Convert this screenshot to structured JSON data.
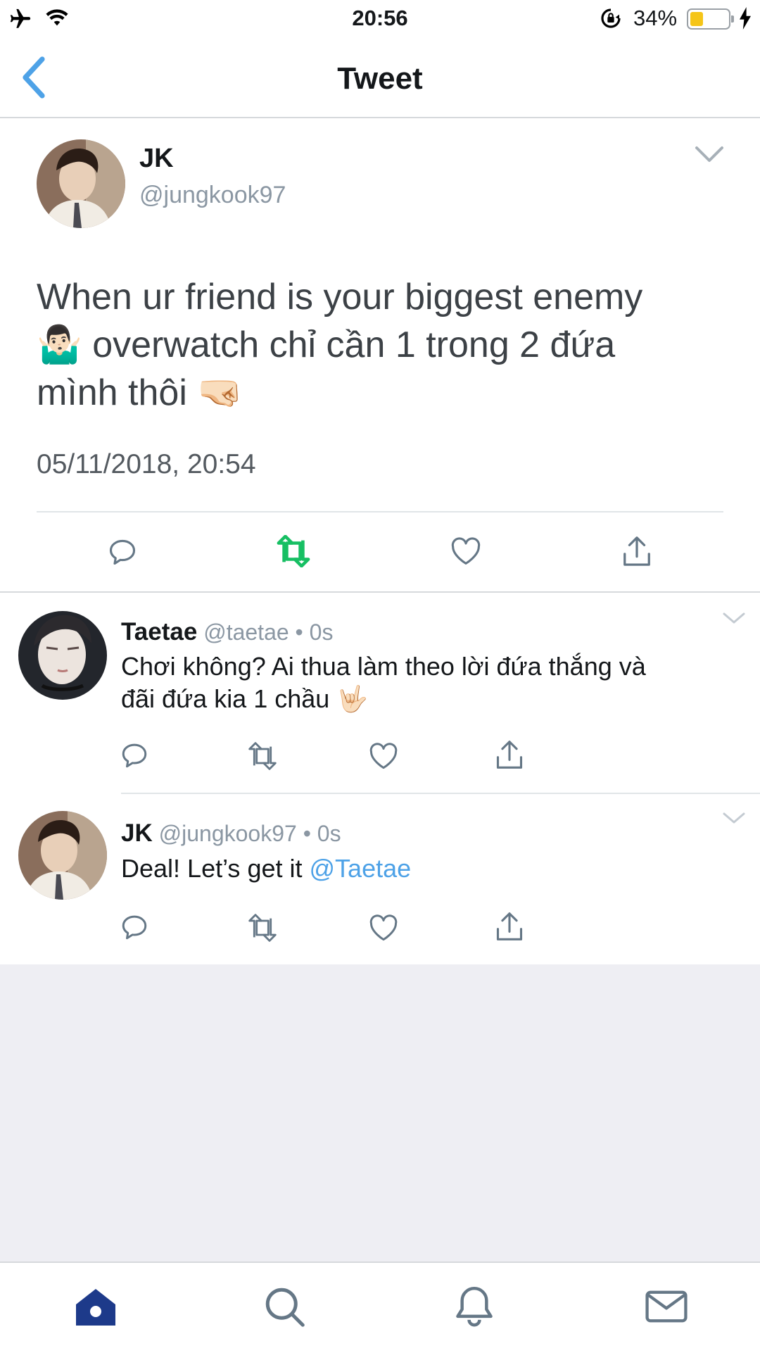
{
  "status_bar": {
    "time": "20:56",
    "battery": "34%",
    "icons": [
      "airplane-icon",
      "wifi-icon",
      "orientation-lock-icon",
      "battery-icon",
      "charging-bolt-icon"
    ]
  },
  "nav": {
    "title": "Tweet",
    "back_icon": "chevron-left-icon"
  },
  "main_tweet": {
    "name": "JK",
    "handle": "@jungkook97",
    "text_line1": "When ur friend is your biggest enemy",
    "text_line2": " overwatch chỉ cần 1 trong 2 đứa",
    "text_line3": "mình thôi ",
    "emoji_1": "🤷🏻‍♂️",
    "emoji_2": "🤜🏻",
    "timestamp": "05/11/2018, 20:54",
    "retweet_active_color": "#17bf63"
  },
  "replies": [
    {
      "name": "Taetae",
      "handle": "@taetae",
      "meta": " • 0s",
      "text_line1": "Chơi không? Ai thua làm theo lời đứa thắng và",
      "text_line2": "đãi đứa kia 1 chầu ",
      "emoji": "🤟🏻"
    },
    {
      "name": "JK",
      "handle": "@jungkook97",
      "meta": " • 0s",
      "text": "Deal! Let’s get it ",
      "mention": "@Taetae"
    }
  ],
  "tabbar": {
    "items": [
      "home-icon",
      "search-icon",
      "notifications-icon",
      "messages-icon"
    ],
    "active_color": "#1d3a8a"
  },
  "colors": {
    "link": "#4ea2e7",
    "icon_gray": "#657786"
  }
}
